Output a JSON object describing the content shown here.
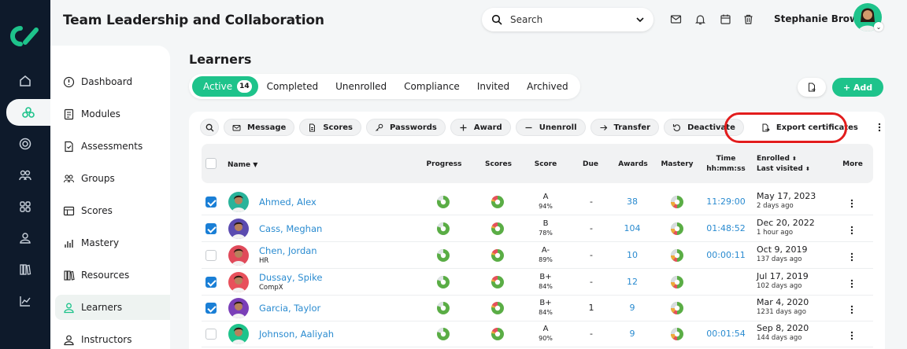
{
  "header": {
    "title": "Team Leadership and Collaboration",
    "search_placeholder": "Search",
    "user_name": "Stephanie Brown"
  },
  "rail_icons": [
    "home-icon",
    "modules-icon",
    "target-icon",
    "people-icon",
    "grid-icon",
    "user-icon",
    "library-icon",
    "chart-icon"
  ],
  "sidebar": {
    "items": [
      {
        "label": "Dashboard",
        "icon": "dashboard-icon"
      },
      {
        "label": "Modules",
        "icon": "modules-icon"
      },
      {
        "label": "Assessments",
        "icon": "assessments-icon"
      },
      {
        "label": "Groups",
        "icon": "groups-icon"
      },
      {
        "label": "Scores",
        "icon": "scores-icon"
      },
      {
        "label": "Mastery",
        "icon": "mastery-icon"
      },
      {
        "label": "Resources",
        "icon": "resources-icon"
      },
      {
        "label": "Learners",
        "icon": "learners-icon",
        "active": true
      },
      {
        "label": "Instructors",
        "icon": "instructors-icon"
      }
    ]
  },
  "main": {
    "title": "Learners",
    "tabs": [
      {
        "label": "Active",
        "count": "14",
        "active": true
      },
      {
        "label": "Completed"
      },
      {
        "label": "Unenrolled"
      },
      {
        "label": "Compliance"
      },
      {
        "label": "Invited"
      },
      {
        "label": "Archived"
      }
    ],
    "add_label": "+ Add"
  },
  "toolbar": {
    "buttons": [
      {
        "label": "Message",
        "icon": "envelope-icon"
      },
      {
        "label": "Scores",
        "icon": "document-icon"
      },
      {
        "label": "Passwords",
        "icon": "key-icon"
      },
      {
        "label": "Award",
        "icon": "plus-icon"
      },
      {
        "label": "Unenroll",
        "icon": "minus-icon"
      },
      {
        "label": "Transfer",
        "icon": "arrow-right-icon"
      },
      {
        "label": "Deactivate",
        "icon": "undo-icon"
      },
      {
        "label": "Export certificates",
        "icon": "file-export-icon",
        "highlighted": true
      }
    ]
  },
  "table": {
    "headers": {
      "name": "Name",
      "progress": "Progress",
      "scores": "Scores",
      "score": "Score",
      "due": "Due",
      "awards": "Awards",
      "mastery": "Mastery",
      "time_line1": "Time",
      "time_line2": "hh:mm:ss",
      "enrolled": "Enrolled",
      "last_visited": "Last visited",
      "more": "More"
    },
    "rows": [
      {
        "name": "Ahmed, Alex",
        "sub": "",
        "checked": true,
        "grade": "A",
        "pct": "94%",
        "due": "-",
        "awards": "38",
        "time": "11:29:00",
        "enrolled": "May 17, 2023",
        "visited": "2 days ago",
        "avatar_color": "#29b39a"
      },
      {
        "name": "Cass, Meghan",
        "sub": "",
        "checked": true,
        "grade": "B",
        "pct": "78%",
        "due": "-",
        "awards": "104",
        "time": "01:48:52",
        "enrolled": "Dec 20, 2022",
        "visited": "1 hour ago",
        "avatar_color": "#5b4bb0"
      },
      {
        "name": "Chen, Jordan",
        "sub": "HR",
        "checked": false,
        "grade": "A-",
        "pct": "89%",
        "due": "-",
        "awards": "10",
        "time": "00:00:11",
        "enrolled": "Oct 9, 2019",
        "visited": "137 days ago",
        "avatar_color": "#e04a5a"
      },
      {
        "name": "Dussay, Spike",
        "sub": "CompX",
        "checked": true,
        "grade": "B+",
        "pct": "84%",
        "due": "-",
        "awards": "12",
        "time": "",
        "enrolled": "Jul 17, 2019",
        "visited": "102 days ago",
        "avatar_color": "#e8505b"
      },
      {
        "name": "Garcia, Taylor",
        "sub": "",
        "checked": true,
        "grade": "B+",
        "pct": "84%",
        "due": "1",
        "awards": "9",
        "time": "",
        "enrolled": "Mar 4, 2020",
        "visited": "1231 days ago",
        "avatar_color": "#7a3fb8"
      },
      {
        "name": "Johnson, Aaliyah",
        "sub": "",
        "checked": false,
        "grade": "A",
        "pct": "90%",
        "due": "-",
        "awards": "9",
        "time": "00:01:54",
        "enrolled": "Sep 8, 2020",
        "visited": "144 days ago",
        "avatar_color": "#1ec38b"
      }
    ]
  },
  "colors": {
    "accent": "#1ec38b",
    "rail": "#0e1a2b",
    "link": "#2a8bd0",
    "highlight": "#e21c1c",
    "checkbox": "#1a7fd6"
  }
}
